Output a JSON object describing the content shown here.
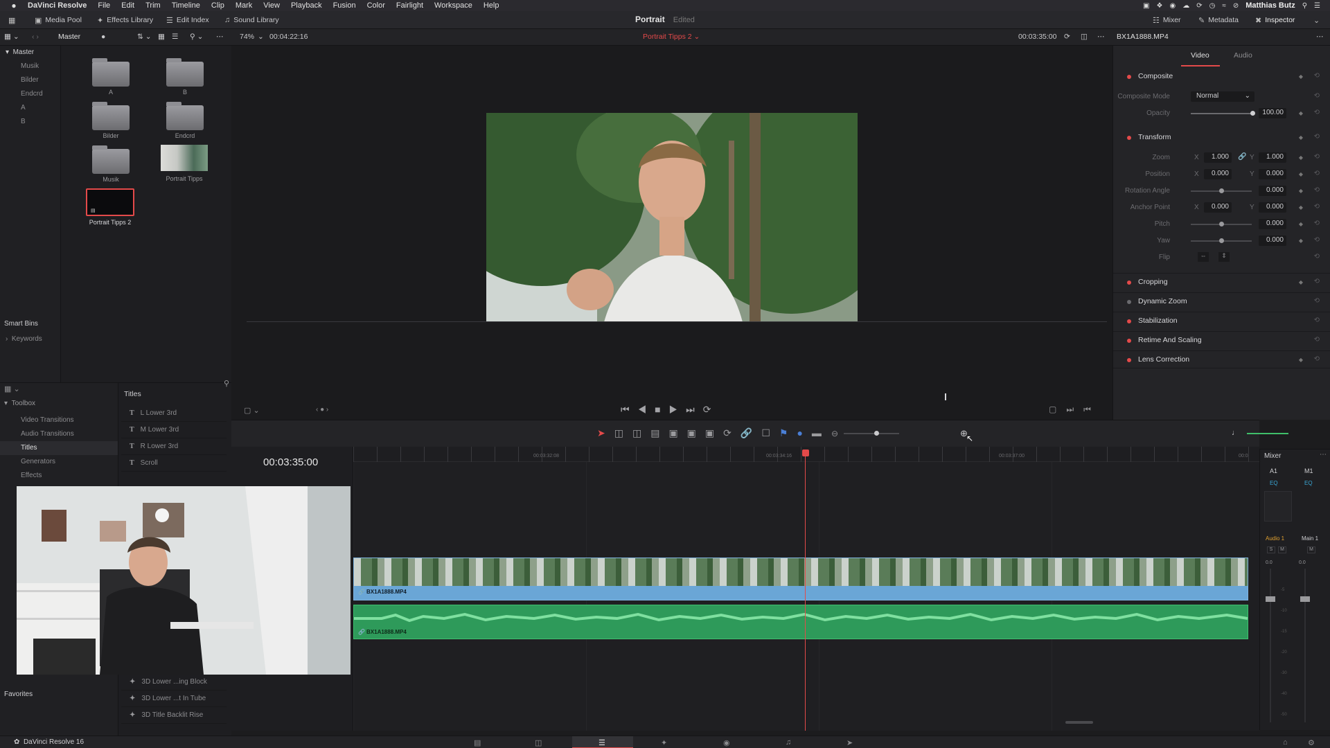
{
  "menubar": {
    "app": "DaVinci Resolve",
    "items": [
      "File",
      "Edit",
      "Trim",
      "Timeline",
      "Clip",
      "Mark",
      "View",
      "Playback",
      "Fusion",
      "Color",
      "Fairlight",
      "Workspace",
      "Help"
    ],
    "user": "Matthias Butz"
  },
  "toolbar": {
    "media_pool": "Media Pool",
    "effects_library": "Effects Library",
    "edit_index": "Edit Index",
    "sound_library": "Sound Library",
    "project": "Portrait",
    "project_status": "Edited",
    "mixer": "Mixer",
    "metadata": "Metadata",
    "inspector": "Inspector"
  },
  "subbar": {
    "bin": "Master",
    "zoom": "74%",
    "timecode_left": "00:04:22:16",
    "timeline_name": "Portrait Tipps 2",
    "timecode_right": "00:03:35:00",
    "clip_name": "BX1A1888.MP4"
  },
  "bins": {
    "master": "Master",
    "items": [
      "Musik",
      "Bilder",
      "Endcrd",
      "A",
      "B"
    ],
    "smart_bins": "Smart Bins",
    "keywords": "Keywords"
  },
  "pool": {
    "items": [
      {
        "label": "A"
      },
      {
        "label": "B"
      },
      {
        "label": "Bilder"
      },
      {
        "label": "Endcrd"
      },
      {
        "label": "Musik"
      },
      {
        "label": "Portrait Tipps"
      },
      {
        "label": "Portrait Tipps 2"
      }
    ]
  },
  "effects": {
    "toolbox": "Toolbox",
    "tree": [
      "Video Transitions",
      "Audio Transitions",
      "Titles",
      "Generators",
      "Effects"
    ],
    "favorites": "Favorites",
    "list_title": "Titles",
    "titles": [
      "L Lower 3rd",
      "M Lower 3rd",
      "R Lower 3rd",
      "Scroll"
    ],
    "fusion_titles": [
      "3D Lower ...ing Block",
      "3D Lower ...t In Tube",
      "3D Title Backlit Rise"
    ]
  },
  "inspector": {
    "tab_video": "Video",
    "tab_audio": "Audio",
    "composite": "Composite",
    "composite_mode_label": "Composite Mode",
    "composite_mode": "Normal",
    "opacity_label": "Opacity",
    "opacity": "100.00",
    "transform": "Transform",
    "zoom_label": "Zoom",
    "zoom_x": "1.000",
    "zoom_y": "1.000",
    "position_label": "Position",
    "position_x": "0.000",
    "position_y": "0.000",
    "rotation_label": "Rotation Angle",
    "rotation": "0.000",
    "anchor_label": "Anchor Point",
    "anchor_x": "0.000",
    "anchor_y": "0.000",
    "pitch_label": "Pitch",
    "pitch": "0.000",
    "yaw_label": "Yaw",
    "yaw": "0.000",
    "flip_label": "Flip",
    "x": "X",
    "y": "Y",
    "cropping": "Cropping",
    "dynamic_zoom": "Dynamic Zoom",
    "stabilization": "Stabilization",
    "retime": "Retime And Scaling",
    "lens": "Lens Correction"
  },
  "timeline": {
    "timecode": "00:03:35:00",
    "ticks": [
      "00:03:32:08",
      "00:03:34:16",
      "00:03:37:00",
      "00:0"
    ],
    "video_clip": "BX1A1888.MP4",
    "audio_clip": "BX1A1888.MP4"
  },
  "mixer": {
    "title": "Mixer",
    "a1": "A1",
    "m1": "M1",
    "eq": "EQ",
    "audio1": "Audio 1",
    "main1": "Main 1",
    "s": "S",
    "m": "M",
    "val": "0.0",
    "scale": [
      "-5",
      "-10",
      "-15",
      "-20",
      "-30",
      "-40",
      "-50"
    ]
  },
  "bottombar": {
    "app": "DaVinci Resolve 16"
  },
  "colors": {
    "accent_red": "#e44a4a",
    "video_clip": "#6aa6d6",
    "audio_clip": "#2e9a5a"
  }
}
